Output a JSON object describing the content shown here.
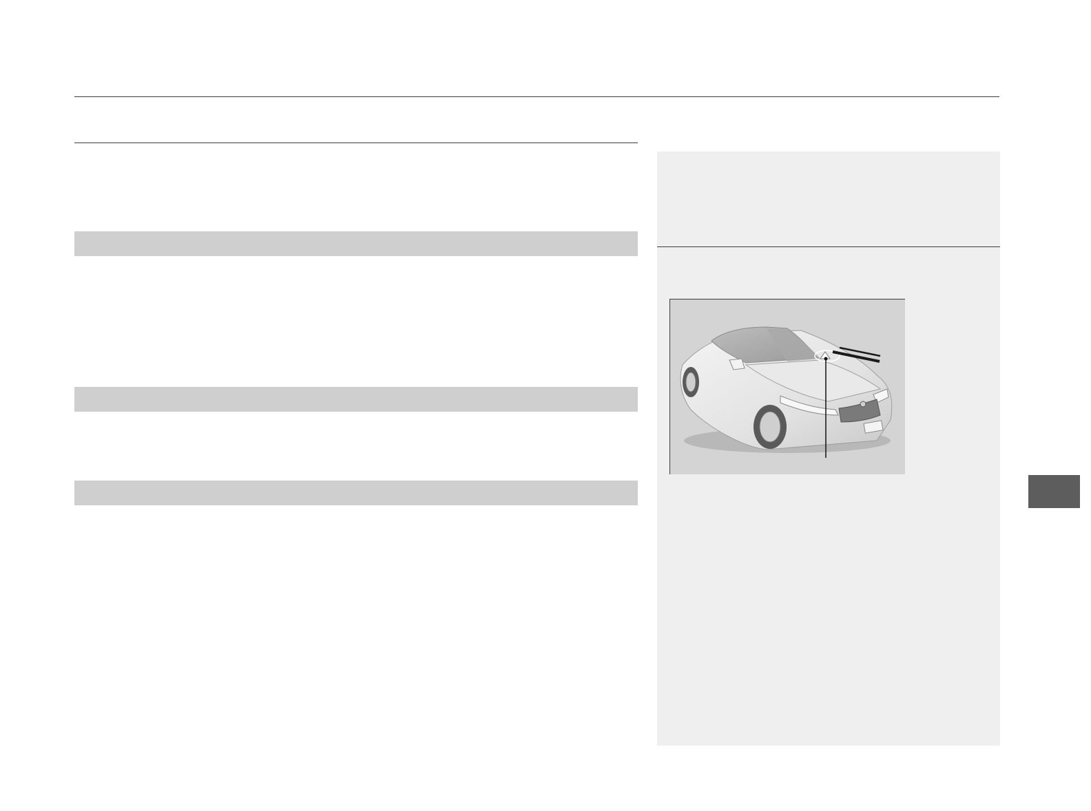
{
  "colors": {
    "rule": "#3a3a3a",
    "section_bar": "#cfcfcf",
    "sidebar_background": "#efefef",
    "figure_background": "#d4d4d4",
    "side_tab": "#5d5d5d"
  },
  "figure": {
    "icon": "car-front-three-quarter-illustration",
    "callout": "hood-release-callout-line"
  }
}
